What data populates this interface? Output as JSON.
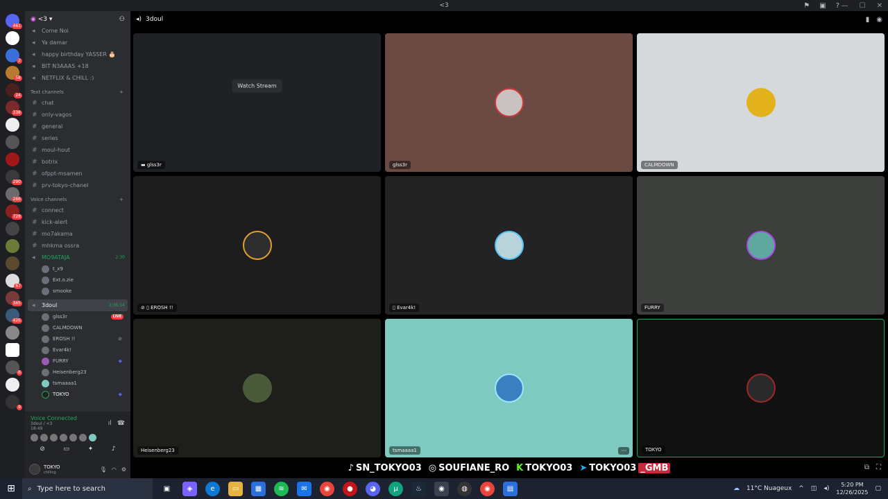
{
  "window": {
    "title": "<3"
  },
  "guild": {
    "name": "<3"
  },
  "channels": {
    "top_voice": [
      "Come Noi",
      "Ya damar",
      "happy birthday YASSER 🎂",
      "BIT N3AAAS +18",
      "NETFLIX & CHILL :)"
    ],
    "text_category": "Text channels",
    "text": [
      "chat",
      "only-vagos",
      "general",
      "series",
      "moul-hout",
      "botrix",
      "ofppt-msamen",
      "prv-tokyo-chanel"
    ],
    "voice_category": "Voice channels",
    "voice": [
      "connect",
      "kick-alert",
      "mo7akama",
      "mhkma ossra"
    ],
    "mo9ataja": {
      "name": "MO9ATAJA",
      "time": "2:30",
      "users": [
        "t_x9",
        "Ext.o.zie",
        "smooke"
      ]
    },
    "current": {
      "name": "3doul",
      "time": "2:36:14"
    },
    "current_users": [
      {
        "name": "glss3r",
        "live": "LIVE"
      },
      {
        "name": "CALMDOWN"
      },
      {
        "name": "EROSH !!"
      },
      {
        "name": "Evar4k!"
      },
      {
        "name": "FURRY"
      },
      {
        "name": "Heisenberg23"
      },
      {
        "name": "tsmaaaa1"
      },
      {
        "name": "TOKYO"
      }
    ]
  },
  "voice_panel": {
    "status": "Voice Connected",
    "sub": "3doul / <3",
    "time": "18:49"
  },
  "user_panel": {
    "name": "TOKYO",
    "status": "chilling"
  },
  "main": {
    "channel": "3doul"
  },
  "tiles": {
    "t1": {
      "name": "glss3r",
      "watch": "Watch Stream"
    },
    "t2": {
      "name": "glss3r"
    },
    "t3": {
      "name": "CALMDOWN"
    },
    "t4": {
      "name": "EROSH !!"
    },
    "t5": {
      "name": "Evar4k!"
    },
    "t6": {
      "name": "FURRY"
    },
    "t7": {
      "name": "Heisenberg23"
    },
    "t8": {
      "name": "tsmaaaa1",
      "more": "···"
    },
    "t9": {
      "name": "TOKYO"
    }
  },
  "overlay": {
    "tiktok": "SN_TOKYO03",
    "instagram": "SOUFIANE_RO",
    "kick": "TOKYO03",
    "telegram": "TOKYO03",
    "gmb": "_GMB"
  },
  "taskbar": {
    "search_placeholder": "Type here to search",
    "weather": "11°C  Nuageux",
    "time": "5:20 PM",
    "date": "12/26/2025"
  }
}
